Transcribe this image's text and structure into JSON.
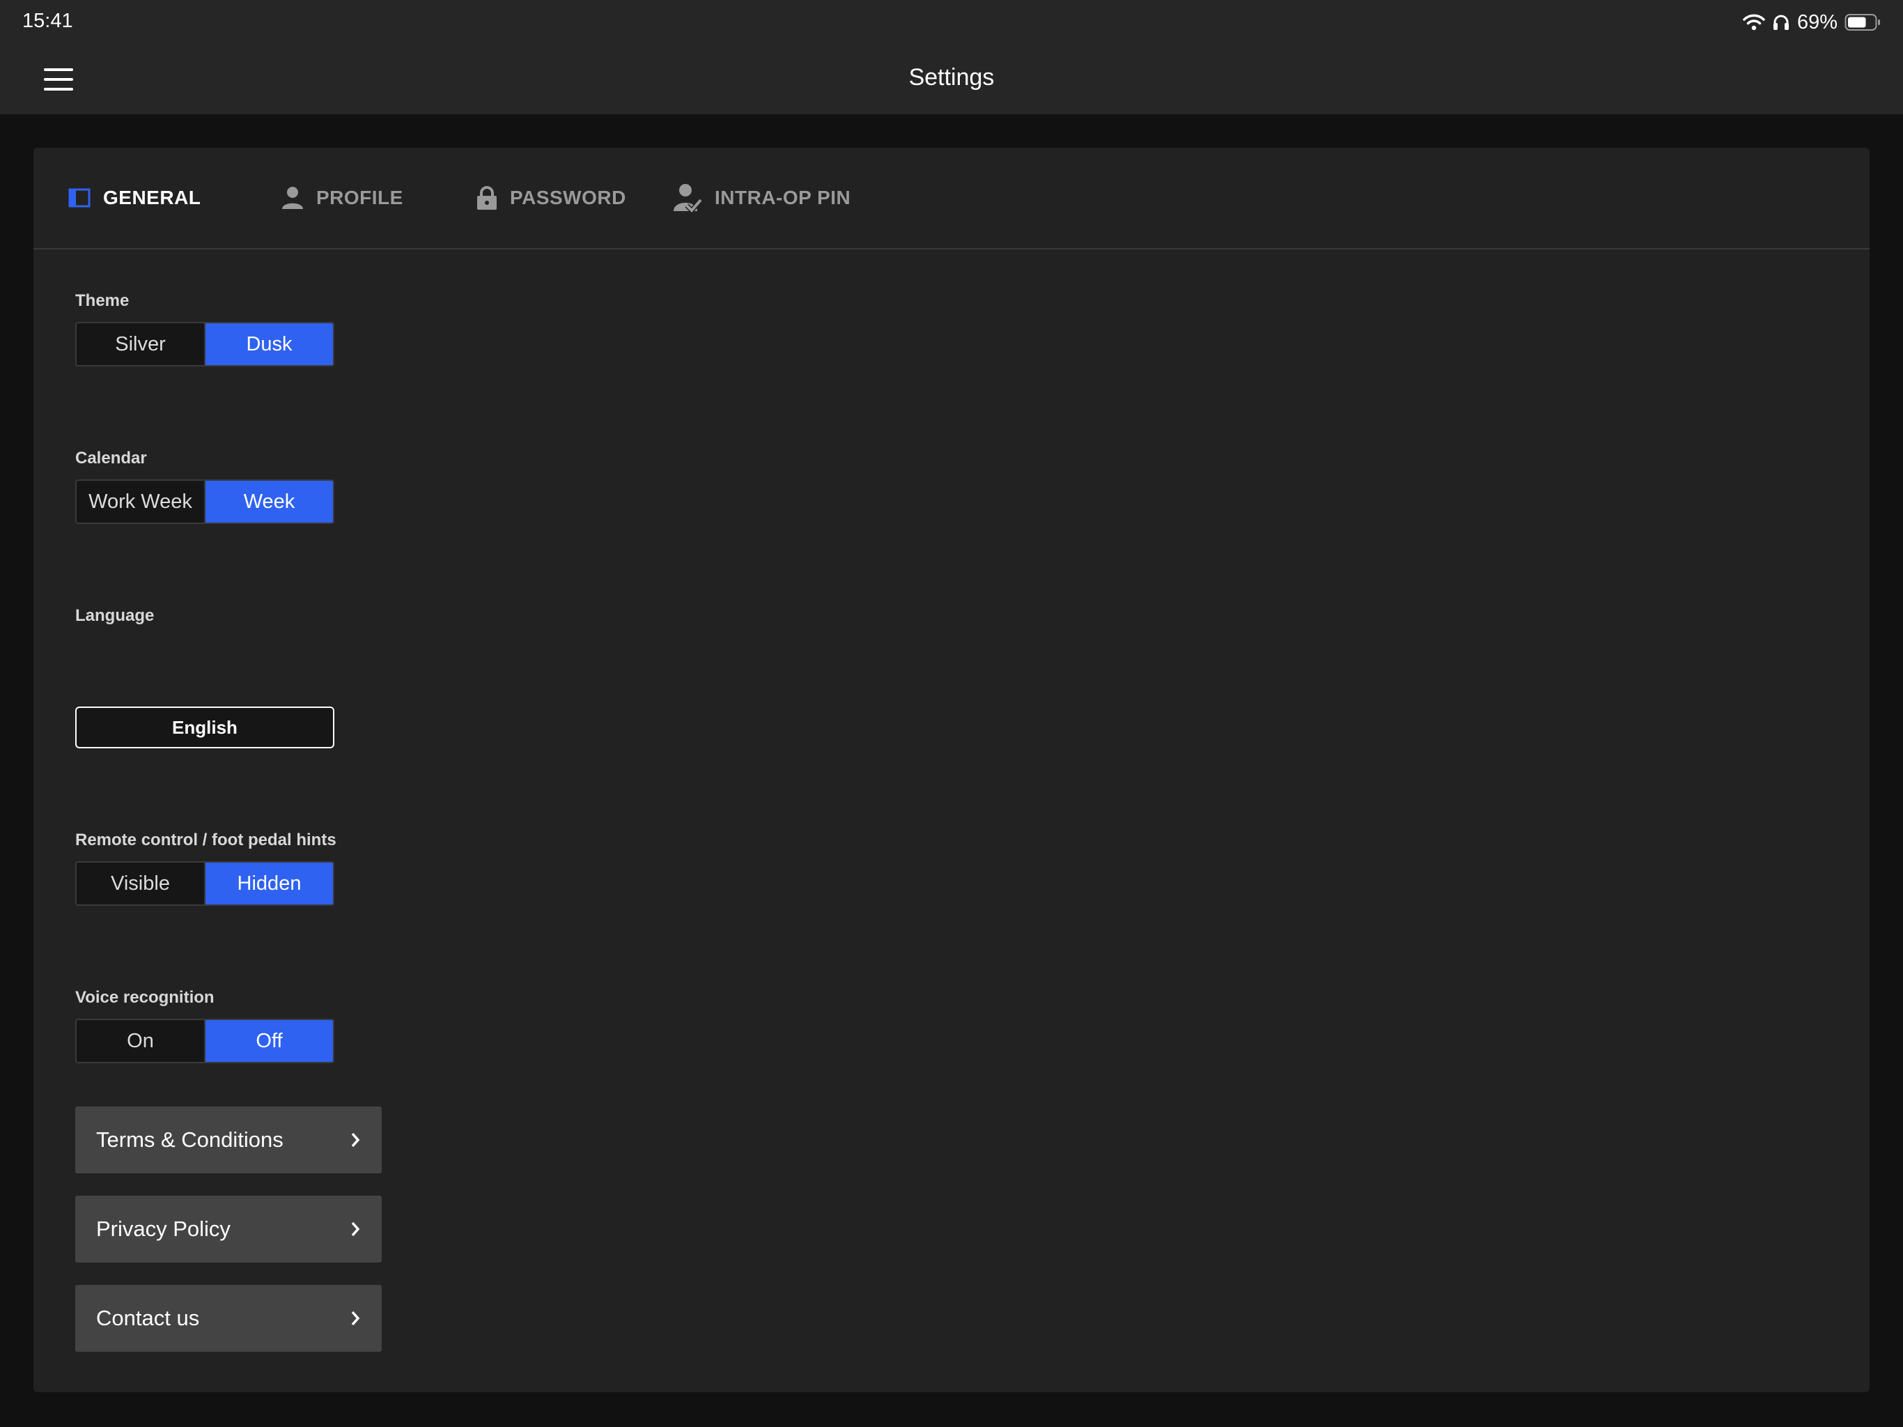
{
  "status_bar": {
    "time": "15:41",
    "battery_percent": "69%",
    "battery_level": 0.69,
    "icons": [
      "wifi-icon",
      "headphones-icon",
      "battery-icon"
    ]
  },
  "nav": {
    "title": "Settings",
    "menu_icon": "hamburger-menu-icon"
  },
  "tabs": [
    {
      "label": "GENERAL",
      "icon": "general-icon",
      "active": true
    },
    {
      "label": "PROFILE",
      "icon": "person-icon",
      "active": false
    },
    {
      "label": "PASSWORD",
      "icon": "lock-icon",
      "active": false
    },
    {
      "label": "INTRA-OP PIN",
      "icon": "user-check-icon",
      "active": false
    }
  ],
  "settings": {
    "theme": {
      "label": "Theme",
      "options": [
        "Silver",
        "Dusk"
      ],
      "selected": "Dusk"
    },
    "calendar": {
      "label": "Calendar",
      "options": [
        "Work Week",
        "Week"
      ],
      "selected": "Week"
    },
    "language": {
      "label": "Language",
      "value": "English"
    },
    "hints": {
      "label": "Remote control / foot pedal hints",
      "options": [
        "Visible",
        "Hidden"
      ],
      "selected": "Hidden"
    },
    "voice": {
      "label": "Voice recognition",
      "options": [
        "On",
        "Off"
      ],
      "selected": "Off"
    }
  },
  "links": [
    {
      "label": "Terms & Conditions"
    },
    {
      "label": "Privacy Policy"
    },
    {
      "label": "Contact us"
    }
  ],
  "colors": {
    "accent": "#2f62f0",
    "background": "#111111",
    "panel": "#222222",
    "bar": "#262626",
    "link_row": "#444444"
  }
}
